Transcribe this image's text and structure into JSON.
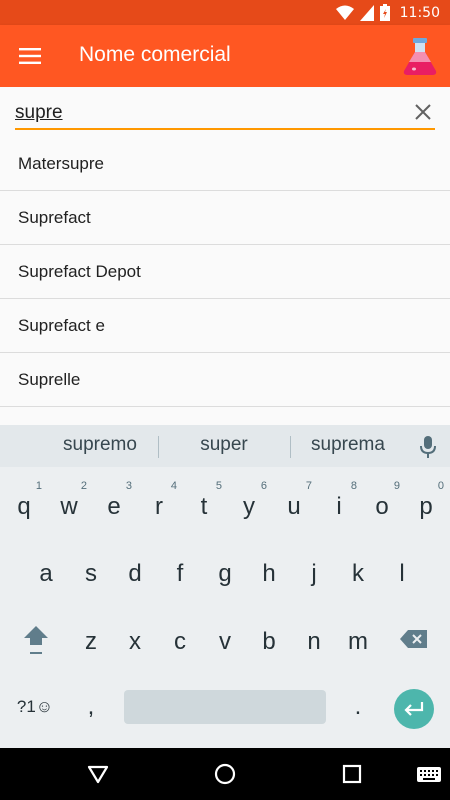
{
  "status_bar": {
    "time": "11:50",
    "color": "#e64a19"
  },
  "app_bar": {
    "title": "Nome comercial",
    "color": "#ff5722"
  },
  "search": {
    "value": "supre"
  },
  "results": [
    "Matersupre",
    "Suprefact",
    "Suprefact Depot",
    "Suprefact e",
    "Suprelle"
  ],
  "keyboard": {
    "suggestions": [
      "supremo",
      "super",
      "suprema"
    ],
    "row1": [
      {
        "k": "q",
        "h": "1"
      },
      {
        "k": "w",
        "h": "2"
      },
      {
        "k": "e",
        "h": "3"
      },
      {
        "k": "r",
        "h": "4"
      },
      {
        "k": "t",
        "h": "5"
      },
      {
        "k": "y",
        "h": "6"
      },
      {
        "k": "u",
        "h": "7"
      },
      {
        "k": "i",
        "h": "8"
      },
      {
        "k": "o",
        "h": "9"
      },
      {
        "k": "p",
        "h": "0"
      }
    ],
    "row2": [
      "a",
      "s",
      "d",
      "f",
      "g",
      "h",
      "j",
      "k",
      "l"
    ],
    "row3": [
      "z",
      "x",
      "c",
      "v",
      "b",
      "n",
      "m"
    ],
    "symbols_label": "?1☺",
    "comma": ",",
    "period": ".",
    "enter_color": "#4db6ac"
  }
}
